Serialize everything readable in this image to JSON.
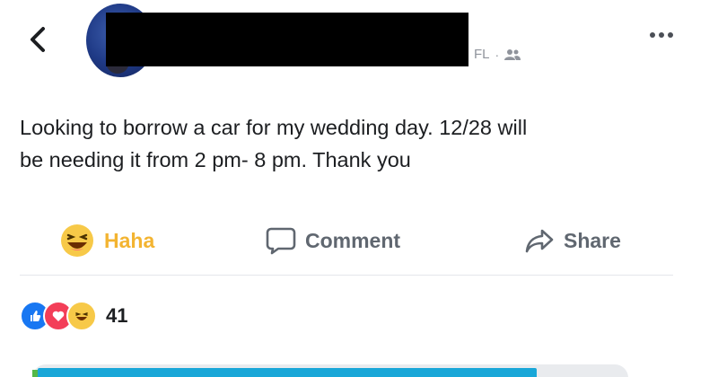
{
  "header": {
    "back_icon": "chevron-left-icon",
    "location": "FL",
    "separator": "·",
    "audience_icon": "friends-icon",
    "more_icon": "more-horizontal-icon"
  },
  "post": {
    "text": "Looking to borrow a car for my wedding day. 12/28 will\nbe needing it from 2 pm- 8 pm. Thank you"
  },
  "actions": {
    "haha_label": "Haha",
    "comment_label": "Comment",
    "share_label": "Share"
  },
  "reactions": {
    "count": "41",
    "types": [
      "like-icon",
      "love-icon",
      "haha-icon"
    ]
  },
  "colors": {
    "haha": "#f3b431",
    "like": "#1877f2",
    "love": "#f33e58",
    "muted": "#606770",
    "meta": "#90949c"
  }
}
